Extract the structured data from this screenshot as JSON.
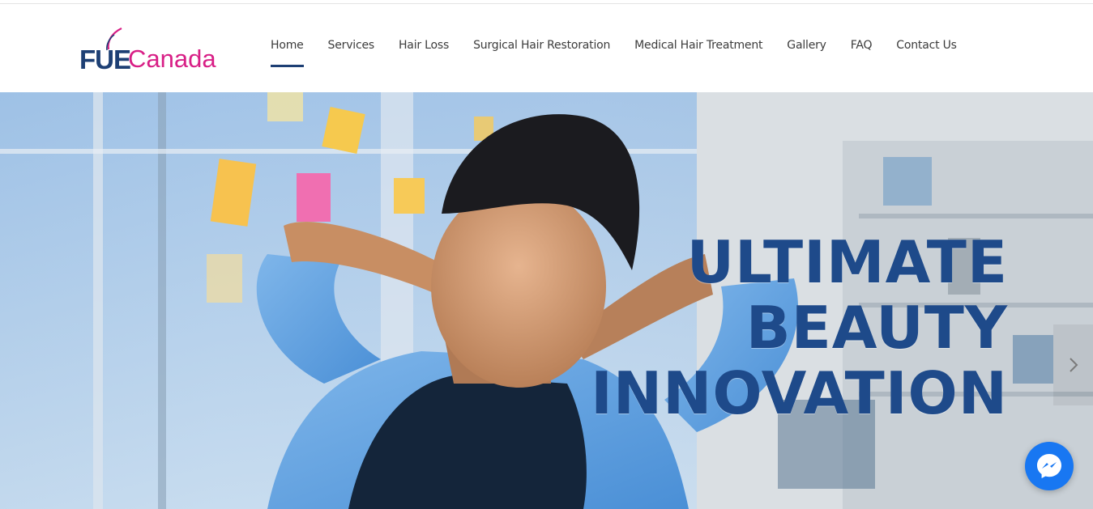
{
  "brand": {
    "logo_fue": "FUE",
    "logo_canada": "Canada"
  },
  "nav": {
    "items": [
      {
        "label": "Home",
        "active": true
      },
      {
        "label": "Services",
        "active": false
      },
      {
        "label": "Hair Loss",
        "active": false
      },
      {
        "label": "Surgical Hair Restoration",
        "active": false
      },
      {
        "label": "Medical Hair Treatment",
        "active": false
      },
      {
        "label": "Gallery",
        "active": false
      },
      {
        "label": "FAQ",
        "active": false
      },
      {
        "label": "Contact Us",
        "active": false
      }
    ]
  },
  "hero": {
    "headline_line1": "ULTIMATE",
    "headline_line2": "BEAUTY",
    "headline_line3": "INNOVATION",
    "next_arrow_icon": "chevron-right-icon"
  },
  "chat": {
    "icon": "messenger-icon"
  },
  "colors": {
    "brand_navy": "#1d3f74",
    "brand_pink": "#d81f86",
    "headline_blue": "#1e4a8a",
    "messenger_blue": "#1877f2"
  }
}
